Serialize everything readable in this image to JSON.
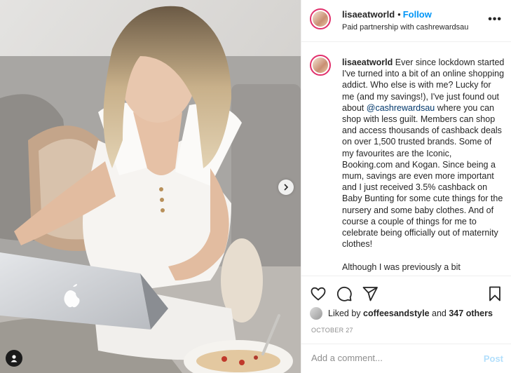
{
  "post": {
    "username": "lisaeatworld",
    "dot": "•",
    "follow_label": "Follow",
    "partnership_text": "Paid partnership with cashrewardsau",
    "more_glyph": "•••",
    "caption_user": "lisaeatworld",
    "caption_part1": "Ever since lockdown started I've turned into a bit of an online shopping addict. Who else is with me? Lucky for me (and my savings!), I've just found out about ",
    "caption_mention": "@cashrewardsau",
    "caption_part2": " where you can shop with less guilt. Members can shop and access thousands of cashback deals on over 1,500 trusted brands. Some of my favourites are the Iconic, Booking.com and Kogan. Since being a mum, savings are even more important and I just received 3.5% cashback on Baby Bunting for some cute things for the nursery and some baby clothes. And of course a couple of things for me to celebrate being officially out of maternity clothes!",
    "caption_cut": "Although I was previously a bit",
    "liked_prefix": "Liked by",
    "liked_user": "coffeesandstyle",
    "liked_and": "and",
    "liked_count": "347 others",
    "date": "OCTOBER 27",
    "comment_placeholder": "Add a comment...",
    "post_label": "Post"
  },
  "icons": {
    "like": "heart-icon",
    "comment": "comment-icon",
    "share": "share-icon",
    "save": "bookmark-icon",
    "next": "chevron-right-icon",
    "user_tags": "user-tag-icon"
  },
  "colors": {
    "accent": "#0095f6",
    "mention": "#00376b",
    "post_disabled": "#b2dffc",
    "muted": "#8e8e8e"
  }
}
